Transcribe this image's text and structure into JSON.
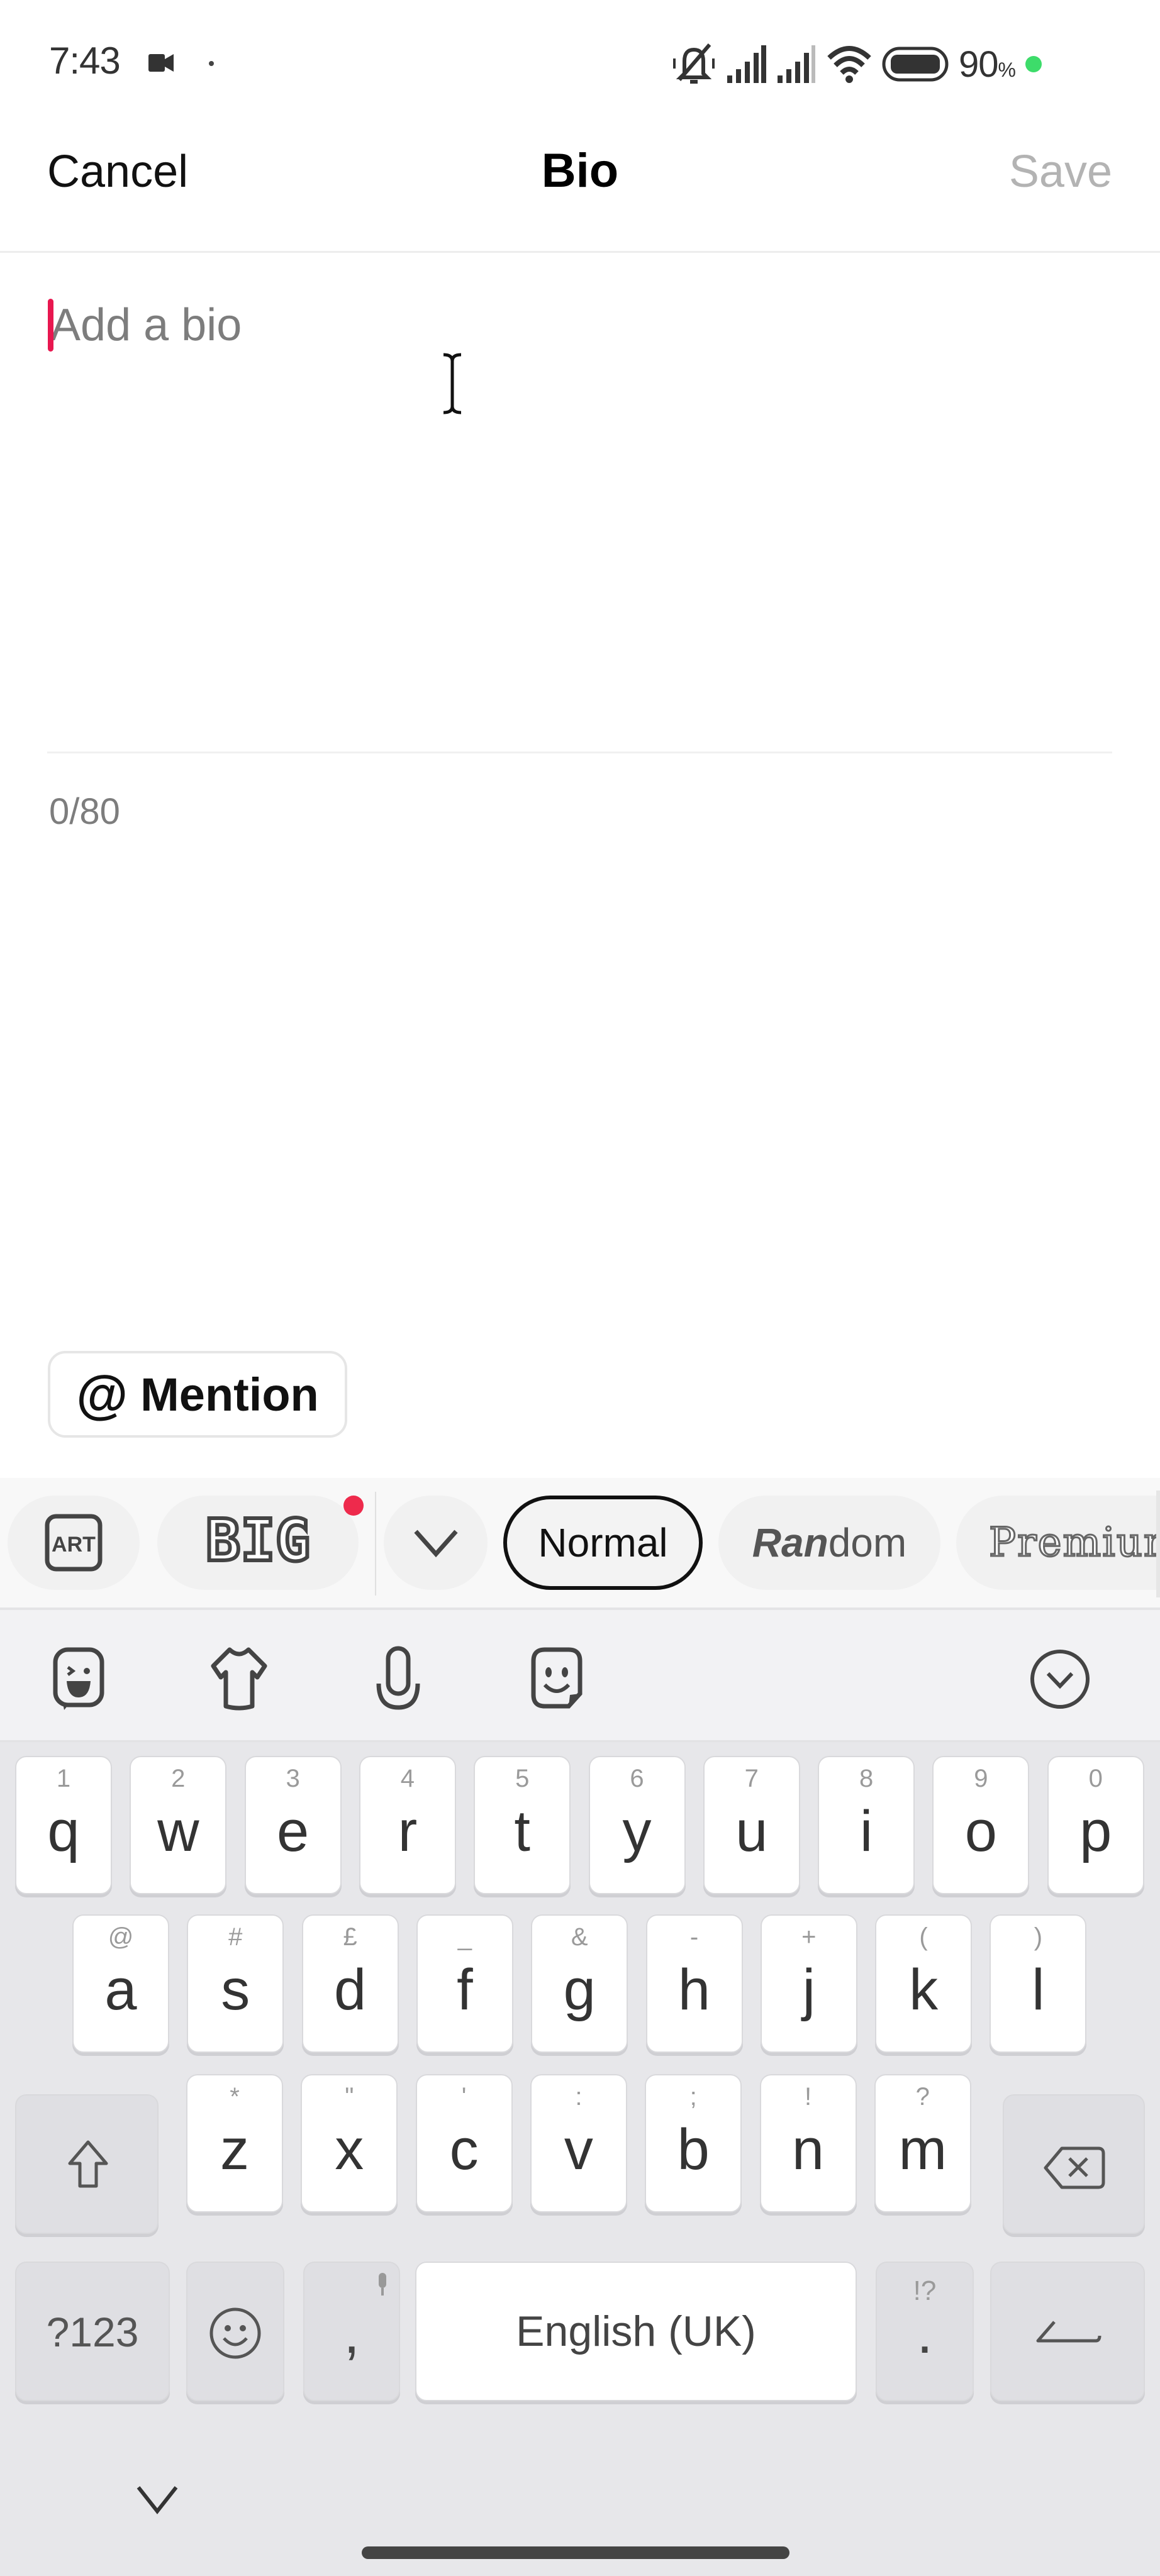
{
  "status_bar": {
    "time": "7:43",
    "battery_percent": "90",
    "battery_unit": "%",
    "icons": [
      "video-camera-icon",
      "notification-dot-icon",
      "silent-bell-icon",
      "signal-sim1-icon",
      "signal-sim2-icon",
      "wifi-icon",
      "battery-icon",
      "charging-dot-icon"
    ],
    "charging_color": "#3ddc6a"
  },
  "header": {
    "cancel_label": "Cancel",
    "title": "Bio",
    "save_label": "Save",
    "save_enabled": false
  },
  "bio": {
    "value": "",
    "placeholder": "Add a bio",
    "char_count": "0/80",
    "caret_color": "#e8174f"
  },
  "mention": {
    "at_symbol": "@",
    "label": "Mention"
  },
  "style_bar": {
    "art_label": "ART",
    "big_label": "BIG",
    "big_has_new_badge": true,
    "chips": [
      {
        "label": "Normal",
        "selected": true
      },
      {
        "label_bold": "Ran",
        "label_rest": "dom",
        "label": "Random",
        "selected": false
      },
      {
        "label": "Premium",
        "selected": false
      }
    ]
  },
  "keyboard": {
    "toolbar_icons": [
      "sticker-emoji-icon",
      "theme-shirt-icon",
      "microphone-icon",
      "sticker-smiley-icon",
      "collapse-chevron-icon"
    ],
    "rows": [
      [
        {
          "k": "q",
          "a": "1"
        },
        {
          "k": "w",
          "a": "2"
        },
        {
          "k": "e",
          "a": "3"
        },
        {
          "k": "r",
          "a": "4"
        },
        {
          "k": "t",
          "a": "5"
        },
        {
          "k": "y",
          "a": "6"
        },
        {
          "k": "u",
          "a": "7"
        },
        {
          "k": "i",
          "a": "8"
        },
        {
          "k": "o",
          "a": "9"
        },
        {
          "k": "p",
          "a": "0"
        }
      ],
      [
        {
          "k": "a",
          "a": "@"
        },
        {
          "k": "s",
          "a": "#"
        },
        {
          "k": "d",
          "a": "£"
        },
        {
          "k": "f",
          "a": "_"
        },
        {
          "k": "g",
          "a": "&"
        },
        {
          "k": "h",
          "a": "-"
        },
        {
          "k": "j",
          "a": "+"
        },
        {
          "k": "k",
          "a": "("
        },
        {
          "k": "l",
          "a": ")"
        }
      ],
      [
        {
          "k": "z",
          "a": "*"
        },
        {
          "k": "x",
          "a": "\""
        },
        {
          "k": "c",
          "a": "'"
        },
        {
          "k": "v",
          "a": ":"
        },
        {
          "k": "b",
          "a": ";"
        },
        {
          "k": "n",
          "a": "!"
        },
        {
          "k": "m",
          "a": "?"
        }
      ]
    ],
    "symbols_label": "?123",
    "comma": ",",
    "space_label": "English (UK)",
    "period": ".",
    "period_alt": "!?",
    "shift_icon": "shift-arrow-icon",
    "backspace_icon": "backspace-icon",
    "enter_icon": "enter-icon",
    "emoji_icon": "emoji-smiley-icon"
  },
  "nav": {
    "hide_keyboard_icon": "chevron-down-icon"
  }
}
